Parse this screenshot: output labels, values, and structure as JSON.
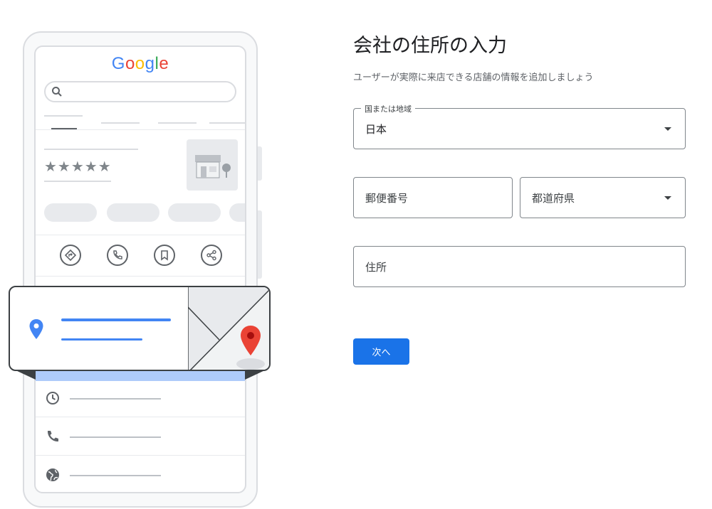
{
  "illustration": {
    "logo": {
      "letters": [
        "G",
        "o",
        "o",
        "g",
        "l",
        "e"
      ],
      "colors": [
        "#4285f4",
        "#ea4335",
        "#fbbc05",
        "#4285f4",
        "#34a853",
        "#ea4335"
      ]
    },
    "rating_stars": "★★★★★",
    "icons": {
      "search": "search-icon",
      "store": "storefront-icon",
      "directions": "directions-icon",
      "call": "phone-icon",
      "save": "bookmark-icon",
      "share": "share-icon",
      "location": "location-pin-icon",
      "hours": "clock-icon",
      "website": "globe-icon"
    },
    "colors": {
      "accent_blue": "#4285f4",
      "pin_red": "#ea4335",
      "band": "#aecbfa"
    }
  },
  "form": {
    "title": "会社の住所の入力",
    "subtitle": "ユーザーが実際に来店できる店舗の情報を追加しましょう",
    "country": {
      "label": "国または地域",
      "value": "日本"
    },
    "postal_code": {
      "placeholder": "郵便番号"
    },
    "prefecture": {
      "placeholder": "都道府県"
    },
    "address": {
      "placeholder": "住所"
    },
    "next_button": "次へ",
    "colors": {
      "primary": "#1a73e8",
      "border": "#80868b"
    }
  }
}
